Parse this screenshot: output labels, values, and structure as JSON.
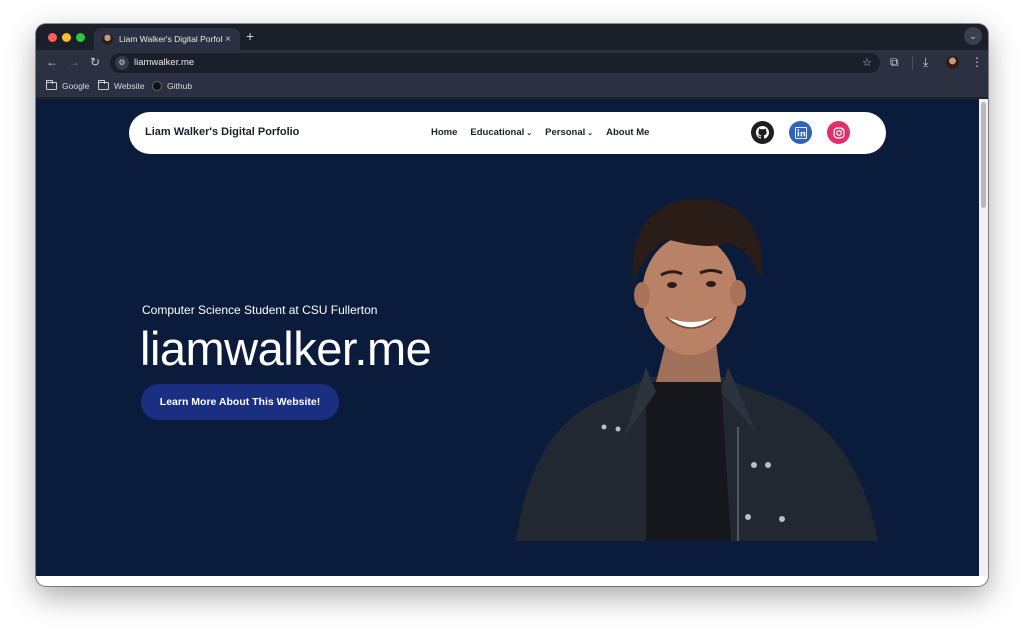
{
  "browser": {
    "tab_title": "Liam Walker's Digital Porfolio",
    "tab_close": "×",
    "new_tab": "+",
    "tab_menu": "⌄",
    "url": "liamwalker.me",
    "bookmarks": [
      "Google",
      "Website",
      "Github"
    ]
  },
  "site": {
    "brand": "Liam Walker's Digital Porfolio",
    "nav": [
      {
        "label": "Home",
        "dropdown": false
      },
      {
        "label": "Educational",
        "dropdown": true
      },
      {
        "label": "Personal",
        "dropdown": true
      },
      {
        "label": "About Me",
        "dropdown": false
      }
    ],
    "social_icons": [
      "github-icon",
      "linkedin-icon",
      "instagram-icon"
    ],
    "hero": {
      "subtitle": "Computer Science Student at CSU Fullerton",
      "title": "liamwalker.me",
      "button": "Learn More About This Website!"
    },
    "colors": {
      "page_bg": "#0b1b3c",
      "button_bg": "#1a2f82",
      "github": "#1f1f1f",
      "linkedin": "#2d64bc",
      "instagram": "#e0306a"
    }
  }
}
